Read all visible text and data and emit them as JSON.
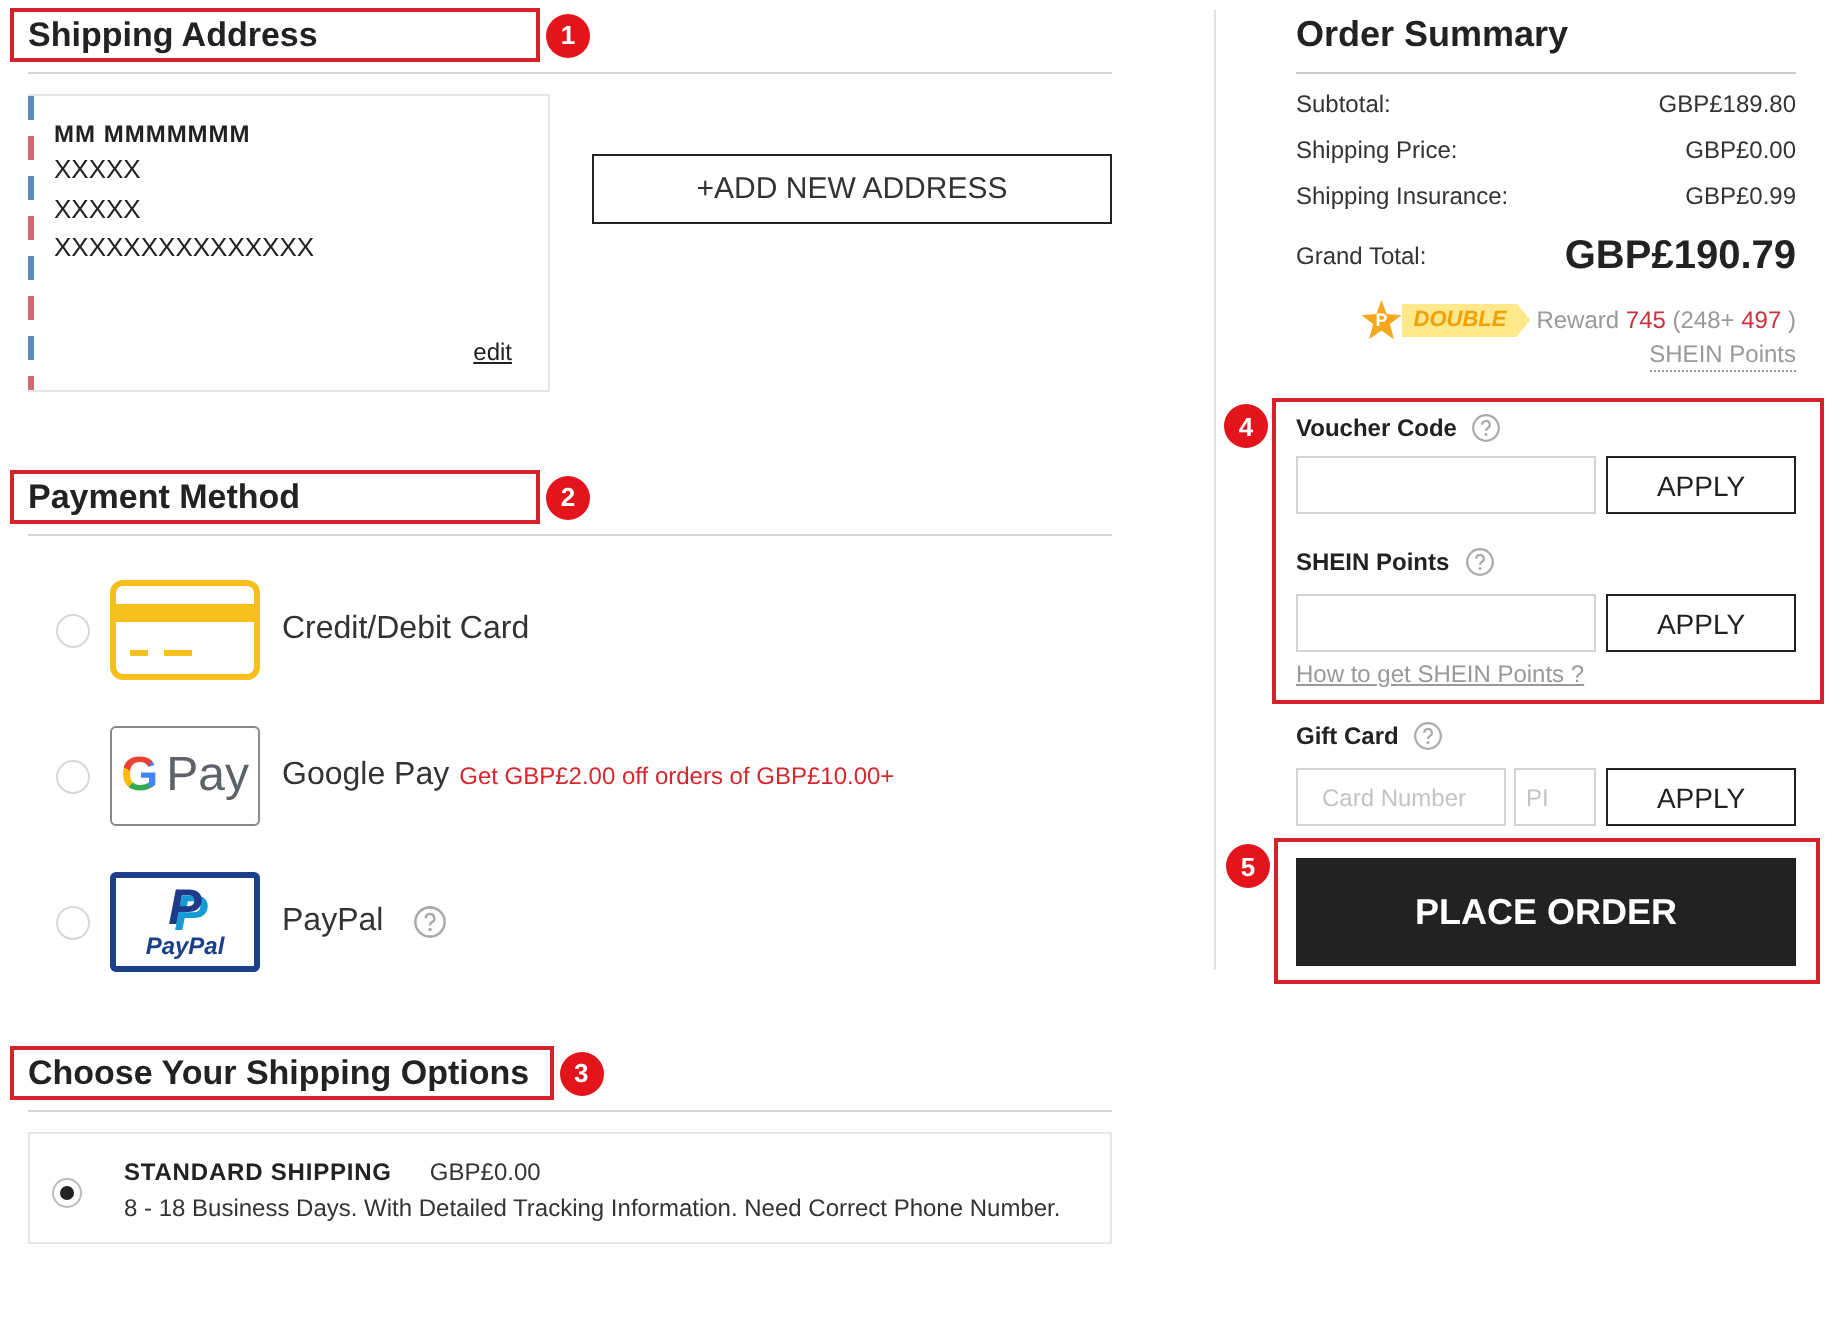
{
  "shipping_address": {
    "heading": "Shipping Address",
    "callout": "1",
    "card": {
      "name": "MM MMMMMMM",
      "lines": [
        "XXXXX",
        "XXXXX",
        "XXXXXXXXXXXXXXX"
      ],
      "edit": "edit"
    },
    "add_button": "+ADD NEW ADDRESS"
  },
  "payment_method": {
    "heading": "Payment Method",
    "callout": "2",
    "options": [
      {
        "kind": "card",
        "label": "Credit/Debit Card",
        "selected": false
      },
      {
        "kind": "gpay",
        "logo_mark": "G",
        "logo_text": "Pay",
        "label": "Google Pay",
        "promo": "Get GBP£2.00 off orders of GBP£10.00+",
        "selected": false
      },
      {
        "kind": "paypal",
        "logo_mark": "P",
        "logo_text": "PayPal",
        "label": "PayPal",
        "help": true,
        "selected": false
      }
    ]
  },
  "shipping_options": {
    "heading": "Choose Your Shipping Options",
    "callout": "3",
    "options": [
      {
        "name": "STANDARD SHIPPING",
        "price": "GBP£0.00",
        "description": "8 - 18 Business Days. With Detailed Tracking Information. Need Correct Phone Number.",
        "selected": true
      }
    ]
  },
  "order_summary": {
    "heading": "Order Summary",
    "rows": [
      {
        "label": "Subtotal:",
        "value": "GBP£189.80"
      },
      {
        "label": "Shipping Price:",
        "value": "GBP£0.00"
      },
      {
        "label": "Shipping Insurance:",
        "value": "GBP£0.99"
      }
    ],
    "grand_total": {
      "label": "Grand Total:",
      "value": "GBP£190.79"
    },
    "reward": {
      "badge_mark": "P",
      "badge": "DOUBLE",
      "label": "Reward",
      "total": "745",
      "base": "(248+",
      "bonus": "497",
      "close": ")",
      "link": "SHEIN Points"
    }
  },
  "discounts": {
    "callout": "4",
    "fields": [
      {
        "label": "Voucher Code",
        "help": true,
        "button": "APPLY"
      },
      {
        "label": "SHEIN Points",
        "help": true,
        "button": "APPLY",
        "link": "How to get SHEIN Points ?"
      }
    ]
  },
  "gift_card": {
    "label": "Gift Card",
    "help": true,
    "card_placeholder": "Card Number",
    "pin_placeholder": "PI",
    "button": "APPLY"
  },
  "place_order": {
    "callout": "5",
    "button": "PLACE ORDER"
  }
}
